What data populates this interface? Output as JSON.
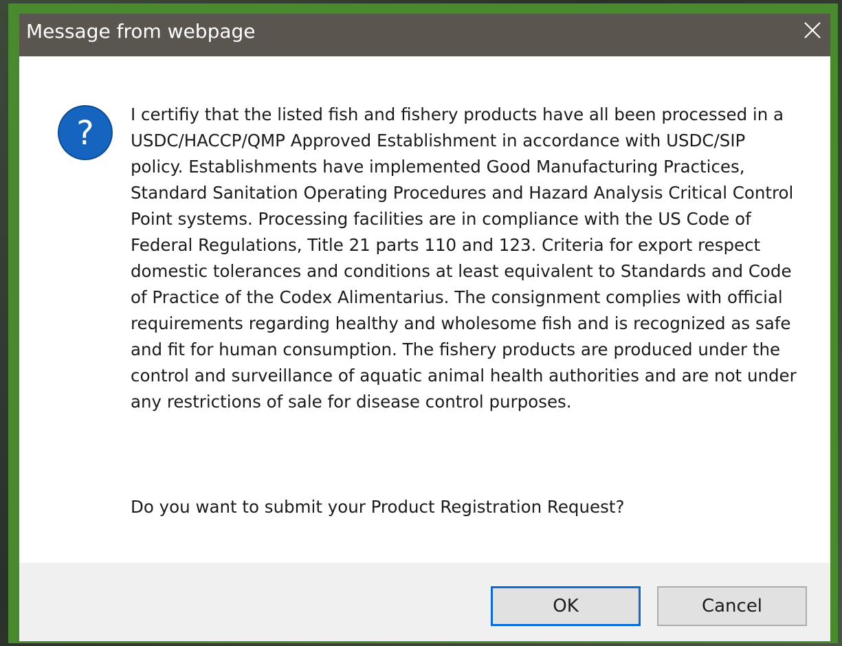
{
  "window": {
    "title": "Message from webpage",
    "close_icon": "close-icon"
  },
  "dialog": {
    "icon": "question-icon",
    "icon_glyph": "?",
    "message": "I certifiy that the listed fish and fishery products have all been processed in a USDC/HACCP/QMP Approved Establishment in accordance with USDC/SIP policy. Establishments have implemented Good Manufacturing Practices, Standard Sanitation Operating Procedures and Hazard Analysis Critical Control Point systems. Processing facilities are in compliance with the US Code of Federal Regulations, Title 21 parts 110 and 123. Criteria for export respect domestic tolerances and conditions at least equivalent to Standards and Code of Practice of the Codex Alimentarius. The consignment complies with official requirements regarding healthy and wholesome fish and is recognized as safe and fit for human consumption. The fishery products are produced under the control and surveillance of aquatic animal health authorities and are not under any restrictions of sale for disease control purposes.",
    "question": "Do you want to submit your Product Registration Request?"
  },
  "buttons": {
    "ok_label": "OK",
    "cancel_label": "Cancel"
  },
  "colors": {
    "titlebar": "#5b5550",
    "frame_border": "#4a8a2e",
    "icon_blue": "#1565c0",
    "focus_blue": "#0a6ad8",
    "footer_bg": "#f0f0f0"
  }
}
